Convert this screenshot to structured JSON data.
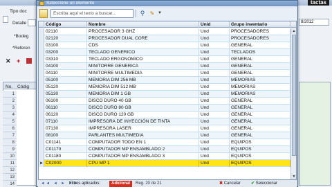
{
  "dialog": {
    "title": "Seleccione un elemento",
    "search_placeholder": "Escriba aquí el texto a buscar...",
    "columns": {
      "code": "Código",
      "name": "Nombre",
      "unit": "Unid",
      "group": "Grupo inventario"
    },
    "rows": [
      {
        "code": "02110",
        "name": "PROCESADOR 3 GHZ",
        "unit": "Und",
        "group": "PROCESADORES"
      },
      {
        "code": "02120",
        "name": "PROCESADOR DUAL CORE",
        "unit": "Und",
        "group": "PROCESADORES"
      },
      {
        "code": "03100",
        "name": "CDS",
        "unit": "Und",
        "group": "GENERAL"
      },
      {
        "code": "03200",
        "name": "TECLADO GENERICO",
        "unit": "Und",
        "group": "TECLADOS"
      },
      {
        "code": "03310",
        "name": "TECLADO ERGONOMICO",
        "unit": "Und",
        "group": "GENERAL"
      },
      {
        "code": "04100",
        "name": "MINITORRE GENERICA",
        "unit": "Und",
        "group": "GENERAL"
      },
      {
        "code": "04110",
        "name": "MINITORRE MULTIMEDIA",
        "unit": "Und",
        "group": "GENERAL"
      },
      {
        "code": "05100",
        "name": "MEMORIA DIM 256 MB",
        "unit": "Und",
        "group": "MEMORIAS"
      },
      {
        "code": "05120",
        "name": "MEMORIA DIM 512 MB",
        "unit": "Und",
        "group": "MEMORIAS"
      },
      {
        "code": "05130",
        "name": "MEMORIA DIM 1 GB",
        "unit": "Und",
        "group": "MEMORIAS"
      },
      {
        "code": "06100",
        "name": "DISCO DURO 40 GB",
        "unit": "Und",
        "group": "GENERAL"
      },
      {
        "code": "06110",
        "name": "DISCO DURO 80 GB",
        "unit": "Und",
        "group": "GENERAL"
      },
      {
        "code": "06120",
        "name": "DISCO DURO 120 GB",
        "unit": "Und",
        "group": "GENERAL"
      },
      {
        "code": "07110",
        "name": "IMPRESORA DE INYECCIÓN DE TINTA",
        "unit": "Und",
        "group": "GENERAL"
      },
      {
        "code": "07130",
        "name": "IMPRESORA LASER",
        "unit": "Und",
        "group": "GENERAL"
      },
      {
        "code": "08100",
        "name": "PARLANTES MULTIMEDIA",
        "unit": "Und",
        "group": "GENERAL"
      },
      {
        "code": "C01141",
        "name": "COMPUTADOR TODO EN 1",
        "unit": "Und",
        "group": "EQUIPOS"
      },
      {
        "code": "C01170",
        "name": "COMPUTADOR MP ENSAMBLADO 2",
        "unit": "Und",
        "group": "EQUIPOS"
      },
      {
        "code": "C01180",
        "name": "COMPUTADOR MP ENSAMBLADO 3",
        "unit": "Und",
        "group": "EQUIPOS"
      },
      {
        "code": "C02000",
        "name": "CPU MP 1",
        "unit": "Und",
        "group": "EQUIPOS"
      }
    ],
    "selected_index": 19,
    "status": {
      "filters_label": "Filtros aplicados:",
      "filter_badge": "Adicional",
      "records": "Reg. 20 de 21",
      "cancel_label": "Cancelar",
      "select_label": "Seleccionar"
    },
    "colors": {
      "selected_row": "#ffe418",
      "badge": "#d72e1e"
    }
  },
  "background": {
    "brand": "tactas",
    "labels": {
      "tipo_doc": "Tipo doc",
      "detalle": "Detalle",
      "bodega": "*Bodeg",
      "referencia": "*Referen",
      "no": "No.",
      "codigo": "Códig"
    },
    "right_value": "8/2012",
    "row_numbers": [
      "1",
      "2",
      "3",
      "4",
      "5",
      "6",
      "7",
      "8",
      "9",
      "10",
      "11",
      "12",
      "13",
      "14"
    ]
  }
}
